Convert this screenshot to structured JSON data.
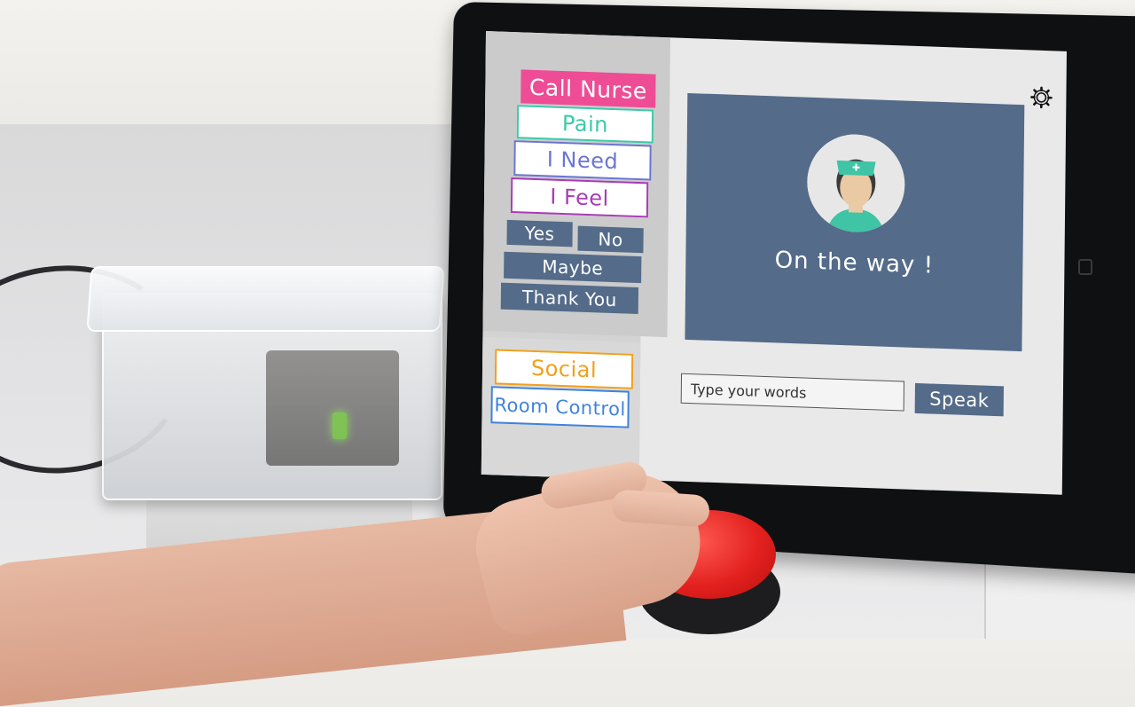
{
  "sidebar": {
    "buttons": [
      {
        "label": "Call Nurse",
        "color": "#ee4d95"
      },
      {
        "label": "Pain",
        "color": "#3cc9a8"
      },
      {
        "label": "I Need",
        "color": "#6a75d2"
      },
      {
        "label": "I Feel",
        "color": "#a83db4"
      },
      {
        "label": "Yes"
      },
      {
        "label": "No"
      },
      {
        "label": "Maybe"
      },
      {
        "label": "Thank You"
      }
    ],
    "bottom_buttons": [
      {
        "label": "Social",
        "color": "#f0a01c"
      },
      {
        "label": "Room Control",
        "color": "#3f82db"
      }
    ]
  },
  "main": {
    "status_text": "On the way !",
    "avatar_icon": "nurse-avatar-icon",
    "settings_icon": "gear-icon"
  },
  "input": {
    "placeholder": "Type your words",
    "speak_label": "Speak"
  },
  "colors": {
    "panel_blue": "#546b89",
    "screen_bg": "#e9e9e9"
  }
}
